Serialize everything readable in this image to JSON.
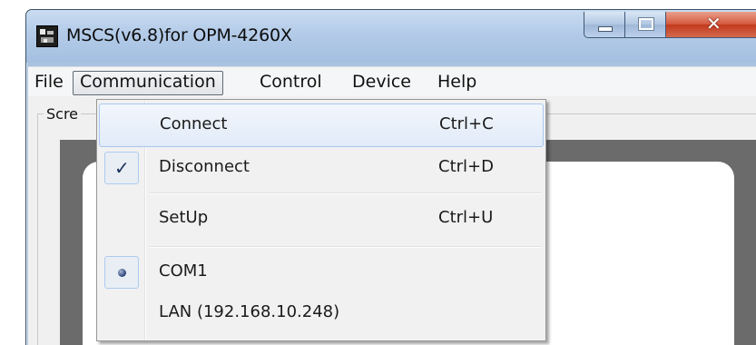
{
  "window": {
    "title": "MSCS(v6.8)for OPM-4260X",
    "close_glyph": "✕",
    "icons": {
      "app": "app-logo-icon",
      "minimize": "minimize-icon",
      "maximize": "maximize-icon",
      "close": "close-icon"
    }
  },
  "menubar": {
    "items": [
      {
        "label": "File"
      },
      {
        "label": "Communication",
        "open": true
      },
      {
        "label": "Control"
      },
      {
        "label": "Device"
      },
      {
        "label": "Help"
      }
    ]
  },
  "client": {
    "group_label": "Scre"
  },
  "dropdown": {
    "items": [
      {
        "label": "Connect",
        "shortcut": "Ctrl+C",
        "highlighted": true
      },
      {
        "label": "Disconnect",
        "shortcut": "Ctrl+D",
        "checked": true,
        "check_glyph": "✓"
      },
      {
        "label": "SetUp",
        "shortcut": "Ctrl+U"
      },
      {
        "label": "COM1",
        "radio_selected": true
      },
      {
        "label": "LAN (192.168.10.248)"
      }
    ]
  },
  "colors": {
    "title_bar": "#b3cbe8",
    "close_button": "#c2391c",
    "menu_background": "#f1f1f1",
    "highlight_border": "#a8c8ef",
    "screen_bezel": "#6b6b6b"
  }
}
